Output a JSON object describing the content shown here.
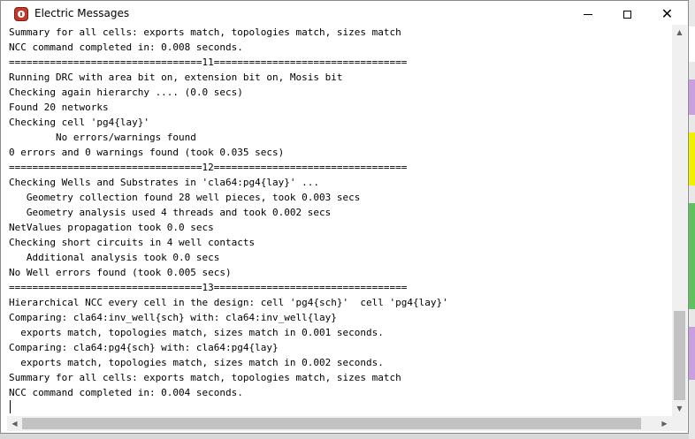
{
  "window": {
    "title": "Electric Messages",
    "app_icon": "electric-app-icon",
    "controls": {
      "minimize_icon": "minimize-icon",
      "maximize_icon": "maximize-icon",
      "close_glyph": "✕"
    }
  },
  "log": {
    "lines": [
      "Summary for all cells: exports match, topologies match, sizes match",
      "NCC command completed in: 0.008 seconds.",
      "=================================11=================================",
      "Running DRC with area bit on, extension bit on, Mosis bit",
      "Checking again hierarchy .... (0.0 secs)",
      "Found 20 networks",
      "Checking cell 'pg4{lay}'",
      "        No errors/warnings found",
      "0 errors and 0 warnings found (took 0.035 secs)",
      "=================================12=================================",
      "Checking Wells and Substrates in 'cla64:pg4{lay}' ...",
      "   Geometry collection found 28 well pieces, took 0.003 secs",
      "   Geometry analysis used 4 threads and took 0.002 secs",
      "NetValues propagation took 0.0 secs",
      "Checking short circuits in 4 well contacts",
      "   Additional analysis took 0.0 secs",
      "No Well errors found (took 0.005 secs)",
      "=================================13=================================",
      "Hierarchical NCC every cell in the design: cell 'pg4{sch}'  cell 'pg4{lay}'",
      "Comparing: cla64:inv_well{sch} with: cla64:inv_well{lay}",
      "  exports match, topologies match, sizes match in 0.001 seconds.",
      "Comparing: cla64:pg4{sch} with: cla64:pg4{lay}",
      "  exports match, topologies match, sizes match in 0.002 seconds.",
      "Summary for all cells: exports match, topologies match, sizes match",
      "NCC command completed in: 0.004 seconds."
    ]
  },
  "scrollbars": {
    "up_glyph": "▲",
    "down_glyph": "▼",
    "left_glyph": "◀",
    "right_glyph": "▶"
  },
  "colors": {
    "background_strip": [
      "#ffffff",
      "#c8a0e0",
      "#f0f000",
      "#60c060",
      "#c8a0e0"
    ]
  }
}
